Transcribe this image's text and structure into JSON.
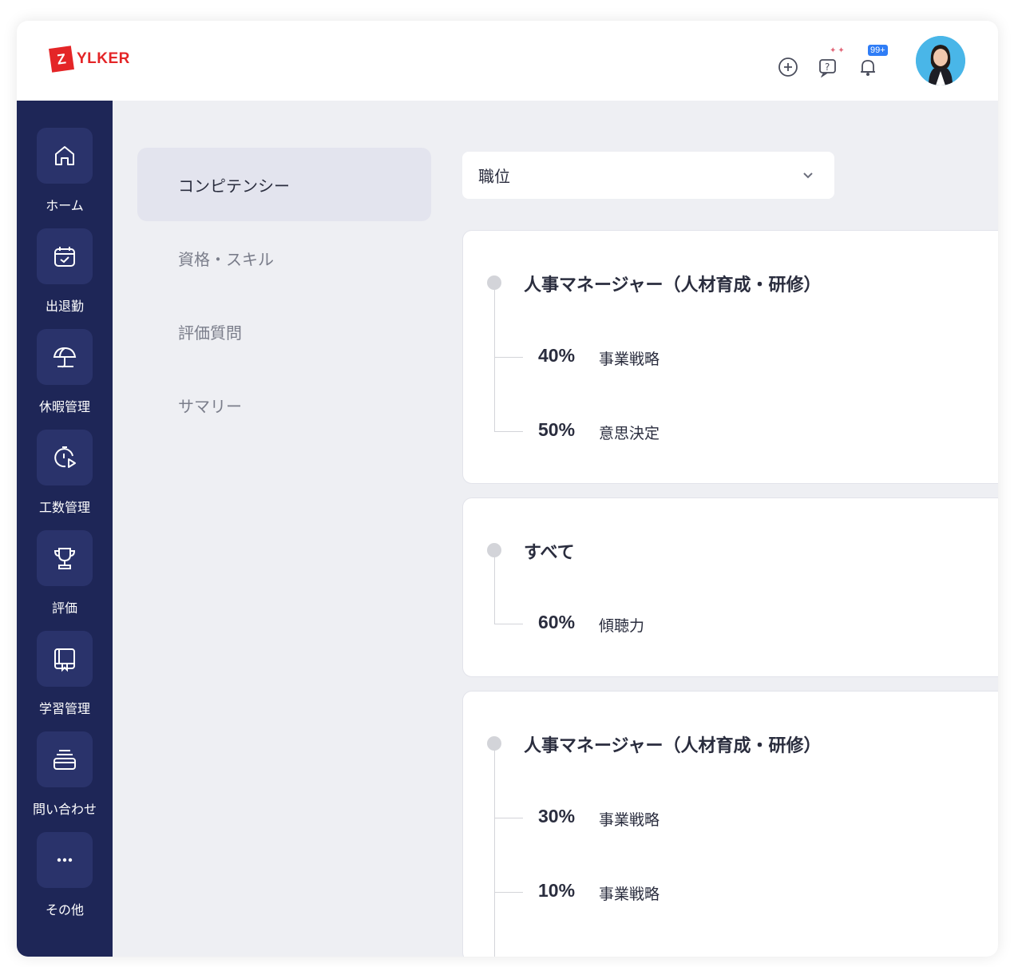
{
  "brand": {
    "logo_letter": "Z",
    "logo_text": "YLKER",
    "color": "#e42527"
  },
  "header": {
    "icons": [
      "add-circle-icon",
      "help-sparkle-icon",
      "bell-icon"
    ],
    "notification_badge": "99+",
    "avatar": "user-avatar"
  },
  "sidebar": {
    "items": [
      {
        "label": "ホーム",
        "icon": "home-icon"
      },
      {
        "label": "出退勤",
        "icon": "calendar-check-icon"
      },
      {
        "label": "休暇管理",
        "icon": "umbrella-icon"
      },
      {
        "label": "工数管理",
        "icon": "timer-icon"
      },
      {
        "label": "評価",
        "icon": "trophy-icon"
      },
      {
        "label": "学習管理",
        "icon": "book-icon"
      },
      {
        "label": "問い合わせ",
        "icon": "tray-icon"
      },
      {
        "label": "その他",
        "icon": "more-icon"
      }
    ]
  },
  "submenu": {
    "items": [
      {
        "label": "コンピテンシー",
        "active": true
      },
      {
        "label": "資格・スキル",
        "active": false
      },
      {
        "label": "評価質問",
        "active": false
      },
      {
        "label": "サマリー",
        "active": false
      }
    ]
  },
  "filter": {
    "selected": "職位"
  },
  "cards": [
    {
      "title": "人事マネージャー（人材育成・研修）",
      "rows": [
        {
          "pct": "40%",
          "label": "事業戦略"
        },
        {
          "pct": "50%",
          "label": "意思決定"
        }
      ]
    },
    {
      "title": "すべて",
      "rows": [
        {
          "pct": "60%",
          "label": "傾聴力"
        }
      ]
    },
    {
      "title": "人事マネージャー（人材育成・研修）",
      "rows": [
        {
          "pct": "30%",
          "label": "事業戦略"
        },
        {
          "pct": "10%",
          "label": "事業戦略"
        }
      ]
    }
  ]
}
